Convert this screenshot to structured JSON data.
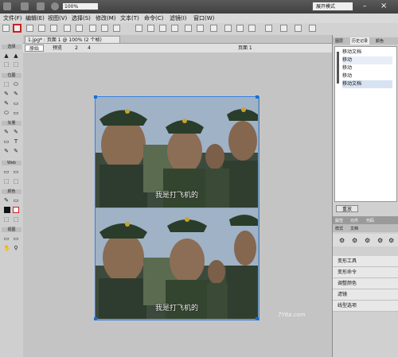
{
  "app": {
    "zoom": "100%",
    "workspace": "展开模式",
    "minimize_symbol": "–",
    "close_symbol": "×",
    "menus": [
      "文件(F)",
      "编辑(E)",
      "视图(V)",
      "选择(S)",
      "修改(M)",
      "文本(T)",
      "命令(C)",
      "滤镜(I)",
      "窗口(W)"
    ]
  },
  "tools": {
    "sections": [
      "选择",
      "位图",
      "矢量",
      "Web",
      "颜色",
      "视图"
    ],
    "glyphs": [
      "▲",
      "⬚",
      "✎",
      "⬭",
      "T",
      "▭",
      "⚲",
      "✋"
    ]
  },
  "document": {
    "tab_title": "1.jpg* : 页面 1 @ 100% (2 个帧)",
    "view_original": "原始",
    "view_preview": "预览",
    "view_2up": "2",
    "view_4up": "4",
    "page_label": "页面 1"
  },
  "photos": {
    "caption_top": "我是打飞机的",
    "caption_bottom": "我是打飞机的"
  },
  "history": {
    "tabs": [
      "图层",
      "历史记录",
      "颜色"
    ],
    "items": [
      "移动文档",
      "移动",
      "移动",
      "移动",
      "移动文档"
    ],
    "replay": "重放"
  },
  "properties": {
    "tabs": [
      "属性",
      "元件",
      "代码"
    ],
    "subtabs": [
      "样式",
      "文档"
    ],
    "items": [
      "变形工具",
      "变形命令",
      "调整颜色",
      "滤镜",
      "线型选项"
    ]
  },
  "watermark": "7Y6a.com",
  "colors": {
    "accent": "#1a6fd4",
    "highlight": "#cc1f1f"
  }
}
